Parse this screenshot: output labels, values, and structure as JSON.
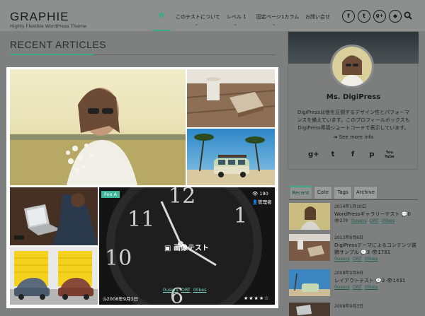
{
  "site": {
    "logo": "GRAPHIE",
    "tagline": "Highly Flexible WordPress Theme"
  },
  "nav": {
    "items": [
      {
        "label": "このテストについて"
      },
      {
        "label": "レベル 1"
      },
      {
        "label": "固定ページ1カラム"
      },
      {
        "label": "お問い合せ"
      }
    ],
    "social": [
      "f",
      "t",
      "g+",
      "◆"
    ]
  },
  "main": {
    "section_title": "RECENT ARTICLES",
    "featured": {
      "category": "Foo A",
      "views": "190",
      "author": "管理者",
      "title": "画像テスト",
      "date": "2008年9月3日",
      "tags": [
        "0users",
        "ORT",
        "0likes"
      ],
      "rating": "★★★★☆",
      "rating_value": 4
    }
  },
  "sidebar": {
    "profile": {
      "name": "Ms. DigiPress",
      "description": "DigiPressは他を圧倒するデザイン性とパフォーマンスを備えています。このプロフィールボックスもDigiPress専用ショートコードで表示しています。",
      "see_more": "See more info",
      "social": [
        "g+",
        "t",
        "f",
        "p",
        "You Tube"
      ]
    },
    "tabs": [
      "Recent",
      "Cate",
      "Tags",
      "Archive"
    ],
    "active_tab": "Recent",
    "posts": [
      {
        "date": "2014年1月10日",
        "title": "WordPressギャラリーテスト",
        "comments": "0",
        "views": "279",
        "tags": [
          "0users",
          "ORT",
          "0likes"
        ]
      },
      {
        "date": "2013年8月8日",
        "title": "DigiPressテーマによるコンテンツ装飾サンプル",
        "comments": "3",
        "views": "1781",
        "tags": [
          "0users",
          "ORT",
          "0likes"
        ]
      },
      {
        "date": "2008年9月8日",
        "title": "レイアウトテスト",
        "comments": "2",
        "views": "1431",
        "tags": [
          "0users",
          "ORT",
          "0likes"
        ]
      },
      {
        "date": "2008年9月3日",
        "title": ""
      }
    ]
  },
  "colors": {
    "accent": "#3aa98c",
    "overlay": "#7e7f7f"
  }
}
